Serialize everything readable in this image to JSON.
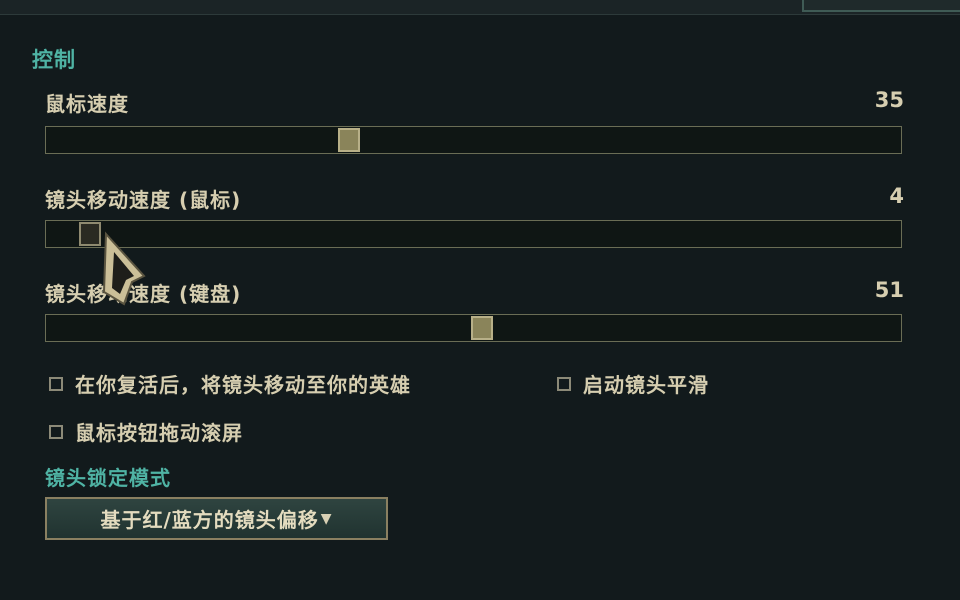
{
  "section": {
    "title": "控制"
  },
  "sliders": [
    {
      "label": "鼠标速度",
      "value": "35",
      "level_percent": 35
    },
    {
      "label": "镜头移动速度 (鼠标)",
      "value": "4",
      "level_percent": 4
    },
    {
      "label": "镜头移动速度 (键盘)",
      "value": "51",
      "level_percent": 51
    }
  ],
  "checkboxes": [
    {
      "label": "在你复活后，将镜头移动至你的英雄",
      "checked": false
    },
    {
      "label": "启动镜头平滑",
      "checked": false
    },
    {
      "label": "鼠标按钮拖动滚屏",
      "checked": false
    }
  ],
  "camera_lock": {
    "title": "镜头锁定模式",
    "selected": "基于红/蓝方的镜头偏移",
    "arrow": "▼"
  },
  "colors": {
    "accent": "#4fb3a4",
    "text": "#d6ceb0",
    "background": "#121a1c"
  }
}
